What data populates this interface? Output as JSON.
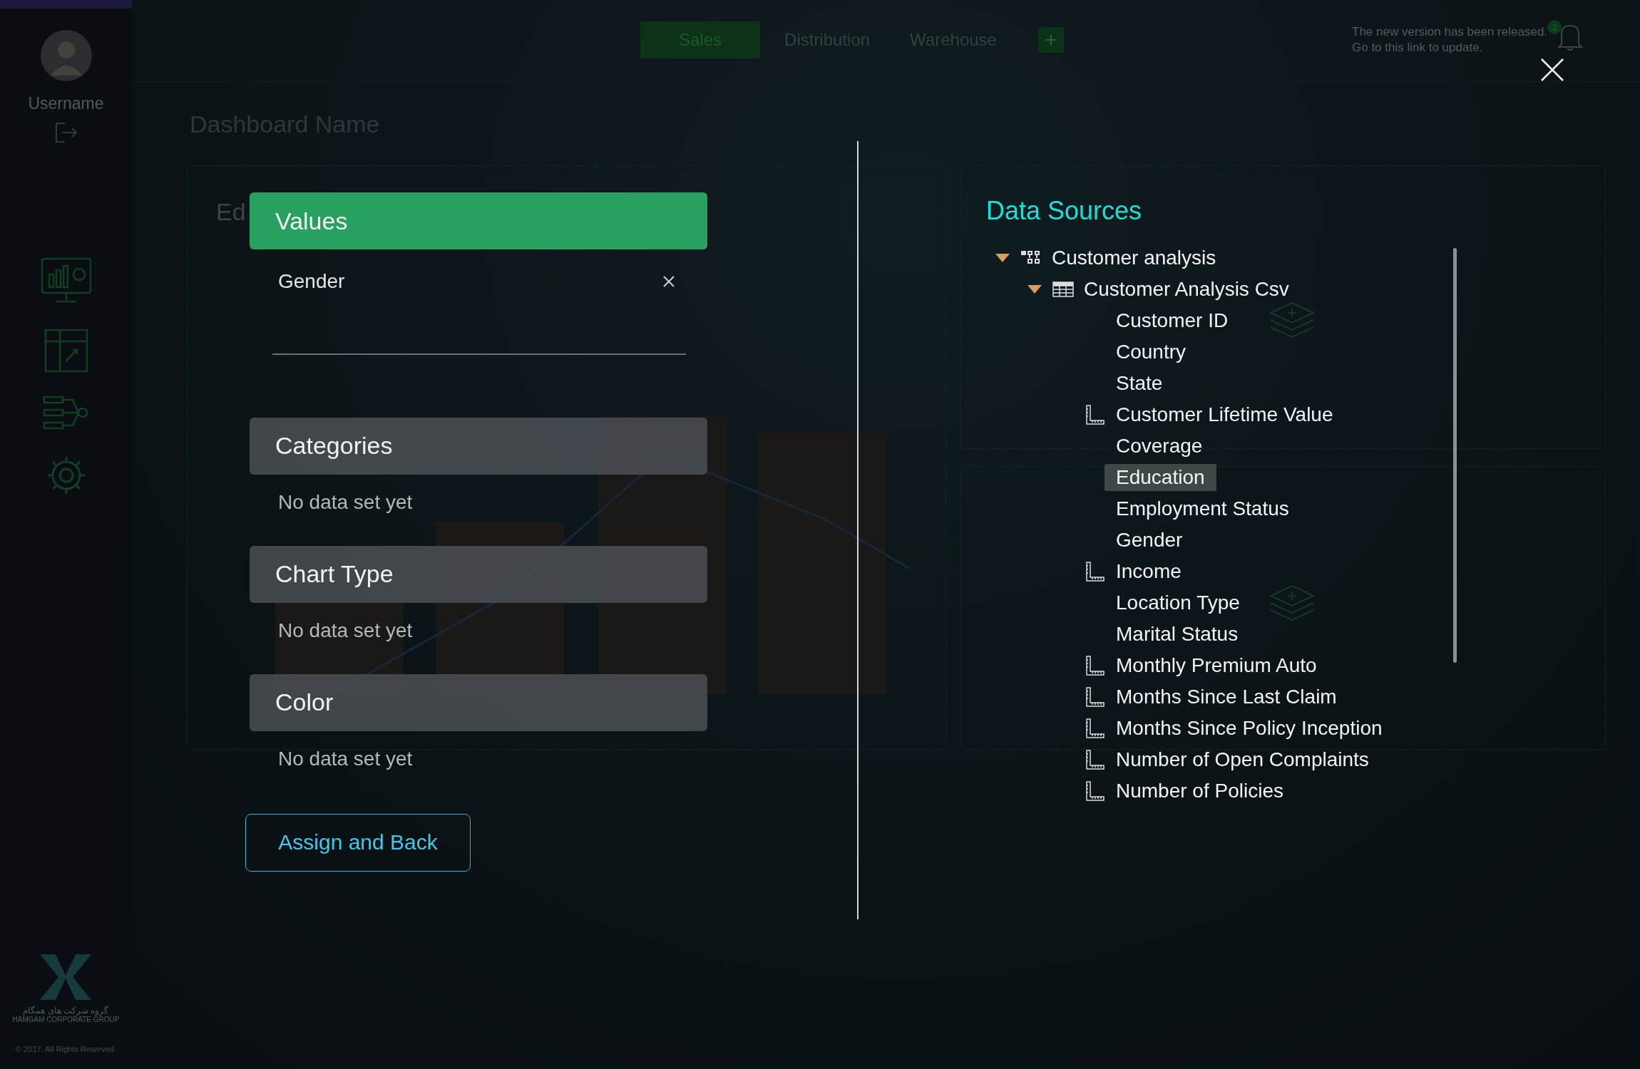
{
  "sidebar": {
    "username": "Username"
  },
  "top_tabs": [
    {
      "label": "Sales",
      "selected": true
    },
    {
      "label": "Distribution",
      "selected": false
    },
    {
      "label": "Warehouse",
      "selected": false
    }
  ],
  "notification": {
    "lines": [
      "The new version has been released.",
      "Go to this link to update."
    ],
    "count": "2"
  },
  "dashboard": {
    "title": "Dashboard Name",
    "panel_label": "Ed"
  },
  "footer": {
    "logo_text_fa": "گروه شرکت های همگام",
    "logo_text_en": "HAMGAM CORPORATE GROUP",
    "copyright": "© 2017. All Rights Reserved."
  },
  "dialog": {
    "sections": [
      {
        "title": "Values",
        "selected": true,
        "items": [
          "Gender"
        ]
      },
      {
        "title": "Categories",
        "selected": false,
        "empty_text": "No data set yet"
      },
      {
        "title": "Chart Type",
        "selected": false,
        "empty_text": "No data set yet"
      },
      {
        "title": "Color",
        "selected": false,
        "empty_text": "No data set yet"
      }
    ],
    "action": "Assign and Back"
  },
  "data_sources": {
    "title": "Data Sources",
    "tree": [
      {
        "label": "Customer analysis",
        "kind": "group",
        "expanded": true,
        "children": [
          {
            "label": "Customer Analysis Csv",
            "kind": "table",
            "expanded": true,
            "children": [
              {
                "label": "Customer ID",
                "kind": "field",
                "selected": false
              },
              {
                "label": "Country",
                "kind": "field",
                "selected": false
              },
              {
                "label": "State",
                "kind": "field",
                "selected": false
              },
              {
                "label": "Customer Lifetime Value",
                "kind": "measure",
                "selected": false
              },
              {
                "label": "Coverage",
                "kind": "field",
                "selected": false
              },
              {
                "label": "Education",
                "kind": "field",
                "selected": true
              },
              {
                "label": "Employment Status",
                "kind": "field",
                "selected": false
              },
              {
                "label": "Gender",
                "kind": "field",
                "selected": false
              },
              {
                "label": "Income",
                "kind": "measure",
                "selected": false
              },
              {
                "label": "Location Type",
                "kind": "field",
                "selected": false
              },
              {
                "label": "Marital Status",
                "kind": "field",
                "selected": false
              },
              {
                "label": "Monthly Premium Auto",
                "kind": "measure",
                "selected": false
              },
              {
                "label": "Months Since Last Claim",
                "kind": "measure",
                "selected": false
              },
              {
                "label": "Months Since Policy Inception",
                "kind": "measure",
                "selected": false
              },
              {
                "label": "Number of Open Complaints",
                "kind": "measure",
                "selected": false
              },
              {
                "label": "Number of Policies",
                "kind": "measure",
                "selected": false
              }
            ]
          }
        ]
      }
    ]
  }
}
